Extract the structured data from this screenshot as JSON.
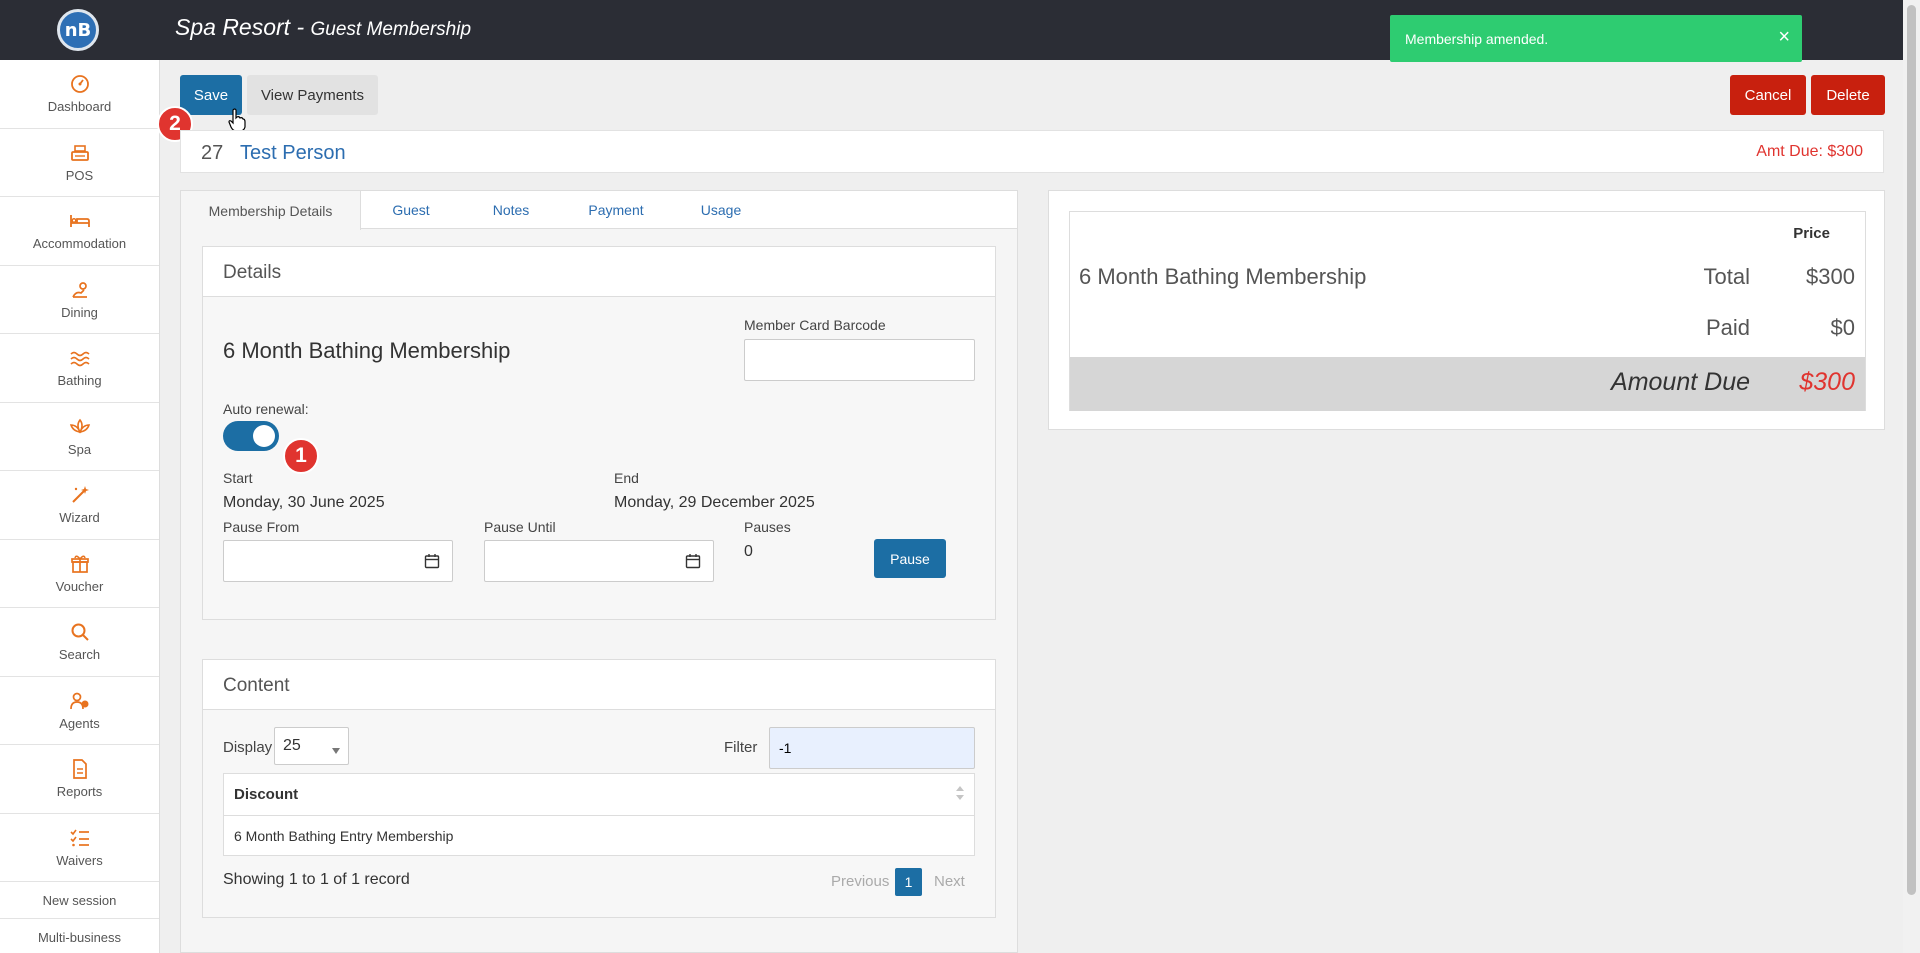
{
  "header": {
    "logo_text": "nB",
    "title": "Spa Resort",
    "subtitle": "Guest Membership",
    "title_sep": " - "
  },
  "sidebar": {
    "items": [
      {
        "label": "Dashboard",
        "icon": "dashboard-icon"
      },
      {
        "label": "POS",
        "icon": "register-icon"
      },
      {
        "label": "Accommodation",
        "icon": "bed-icon"
      },
      {
        "label": "Dining",
        "icon": "dining-icon"
      },
      {
        "label": "Bathing",
        "icon": "waves-icon"
      },
      {
        "label": "Spa",
        "icon": "lotus-icon"
      },
      {
        "label": "Wizard",
        "icon": "magic-wand-icon"
      },
      {
        "label": "Voucher",
        "icon": "gift-icon"
      },
      {
        "label": "Search",
        "icon": "search-icon"
      },
      {
        "label": "Agents",
        "icon": "agents-icon"
      },
      {
        "label": "Reports",
        "icon": "document-icon"
      },
      {
        "label": "Waivers",
        "icon": "checklist-icon"
      }
    ],
    "new_session": "New session",
    "multi_business": "Multi-business"
  },
  "toast": {
    "message": "Membership amended.",
    "close": "×"
  },
  "toolbar": {
    "save": "Save",
    "view_payments": "View Payments",
    "cancel": "Cancel",
    "delete": "Delete"
  },
  "badges": {
    "one": "1",
    "two": "2"
  },
  "person": {
    "id": "27",
    "name": "Test Person",
    "amt_due": "Amt Due: $300"
  },
  "tabs": [
    "Membership Details",
    "Guest",
    "Notes",
    "Payment",
    "Usage"
  ],
  "details": {
    "heading": "Details",
    "membership_name": "6 Month Bathing Membership",
    "barcode_label": "Member Card Barcode",
    "barcode_value": "",
    "auto_renewal_label": "Auto renewal:",
    "auto_renewal_on": true,
    "start_label": "Start",
    "start_value": "Monday, 30 June 2025",
    "end_label": "End",
    "end_value": "Monday, 29 December 2025",
    "pause_from_label": "Pause From",
    "pause_until_label": "Pause Until",
    "pauses_label": "Pauses",
    "pauses_value": "0",
    "pause_button": "Pause"
  },
  "content": {
    "heading": "Content",
    "display_label": "Display",
    "display_value": "25",
    "filter_label": "Filter",
    "filter_value": "-1",
    "column": "Discount",
    "rows": [
      "6 Month Bathing Entry Membership"
    ],
    "showing": "Showing 1 to 1 of 1 record",
    "previous": "Previous",
    "page": "1",
    "next": "Next"
  },
  "price": {
    "header": "Price",
    "membership_name": "6 Month Bathing Membership",
    "total_label": "Total",
    "total_value": "$300",
    "paid_label": "Paid",
    "paid_value": "$0",
    "amount_due_label": "Amount Due",
    "amount_due_value": "$300"
  },
  "colors": {
    "accent": "#1c6ea4",
    "danger": "#c8200e",
    "success": "#2ecc71",
    "sidebar_icon": "#e8731f"
  }
}
